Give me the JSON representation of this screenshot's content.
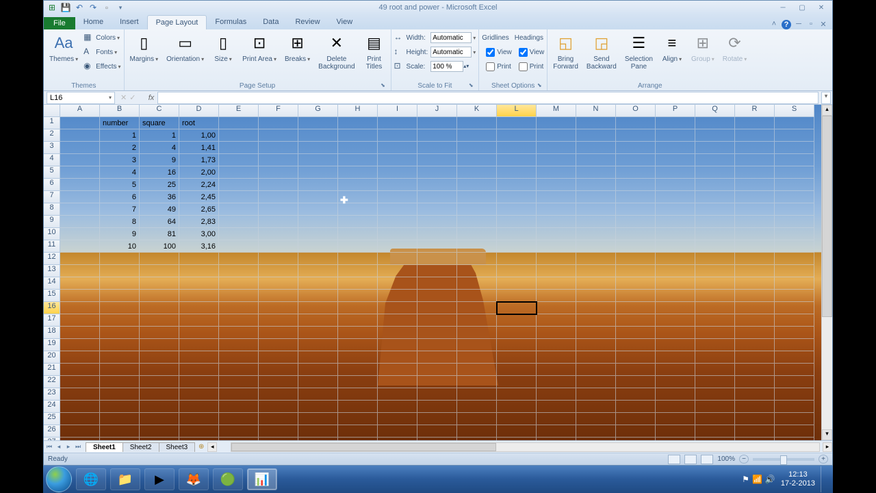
{
  "titlebar": {
    "title": "49 root and power - Microsoft Excel"
  },
  "tabs": {
    "file": "File",
    "list": [
      "Home",
      "Insert",
      "Page Layout",
      "Formulas",
      "Data",
      "Review",
      "View"
    ],
    "active": "Page Layout"
  },
  "ribbon": {
    "themes": {
      "label": "Themes",
      "themes_btn": "Themes",
      "colors": "Colors",
      "fonts": "Fonts",
      "effects": "Effects"
    },
    "pagesetup": {
      "label": "Page Setup",
      "margins": "Margins",
      "orientation": "Orientation",
      "size": "Size",
      "printarea": "Print\nArea",
      "breaks": "Breaks",
      "deletebg": "Delete\nBackground",
      "printtitles": "Print\nTitles"
    },
    "scale": {
      "label": "Scale to Fit",
      "width": "Width:",
      "height": "Height:",
      "scale": "Scale:",
      "width_val": "Automatic",
      "height_val": "Automatic",
      "scale_val": "100 %"
    },
    "sheetopts": {
      "label": "Sheet Options",
      "gridlines": "Gridlines",
      "headings": "Headings",
      "view": "View",
      "print": "Print"
    },
    "arrange": {
      "label": "Arrange",
      "bringfwd": "Bring\nForward",
      "sendback": "Send\nBackward",
      "selpane": "Selection\nPane",
      "align": "Align",
      "group": "Group",
      "rotate": "Rotate"
    }
  },
  "namebox": {
    "ref": "L16"
  },
  "columns": [
    "A",
    "B",
    "C",
    "D",
    "E",
    "F",
    "G",
    "H",
    "I",
    "J",
    "K",
    "L",
    "M",
    "N",
    "O",
    "P",
    "Q",
    "R",
    "S"
  ],
  "selected_col": "L",
  "selected_row": 16,
  "rows_count": 27,
  "headers": {
    "B": "number",
    "C": "square",
    "D": "root"
  },
  "chart_data": {
    "type": "table",
    "columns": [
      "number",
      "square",
      "root"
    ],
    "rows": [
      [
        1,
        1,
        "1,00"
      ],
      [
        2,
        4,
        "1,41"
      ],
      [
        3,
        9,
        "1,73"
      ],
      [
        4,
        16,
        "2,00"
      ],
      [
        5,
        25,
        "2,24"
      ],
      [
        6,
        36,
        "2,45"
      ],
      [
        7,
        49,
        "2,65"
      ],
      [
        8,
        64,
        "2,83"
      ],
      [
        9,
        81,
        "3,00"
      ],
      [
        10,
        100,
        "3,16"
      ]
    ]
  },
  "sheets": {
    "list": [
      "Sheet1",
      "Sheet2",
      "Sheet3"
    ],
    "active": "Sheet1"
  },
  "statusbar": {
    "ready": "Ready",
    "zoom": "100%"
  },
  "taskbar": {
    "apps": [
      {
        "name": "ie",
        "glyph": "🌐"
      },
      {
        "name": "explorer",
        "glyph": "📁"
      },
      {
        "name": "wmp",
        "glyph": "▶"
      },
      {
        "name": "firefox",
        "glyph": "🦊"
      },
      {
        "name": "chrome",
        "glyph": "🟢"
      },
      {
        "name": "excel",
        "glyph": "📊",
        "active": true
      }
    ],
    "time": "12:13",
    "date": "17-2-2013"
  }
}
